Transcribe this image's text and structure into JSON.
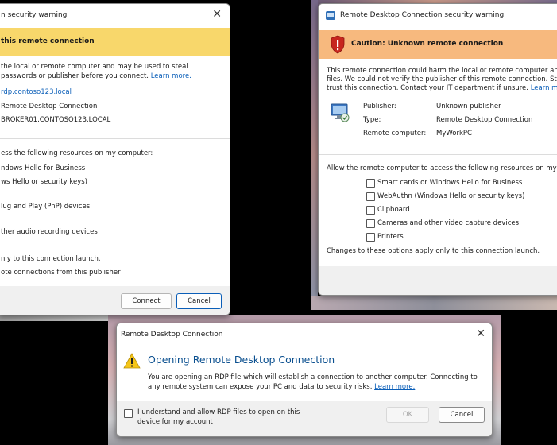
{
  "left_dialog": {
    "title": "n security warning",
    "banner": "this remote connection",
    "desc": "the local or remote computer and may be used to steal passwords or publisher before you connect.",
    "learn_more": "Learn more.",
    "info_values": [
      "rdp.contoso123.local",
      "Remote Desktop Connection",
      "BROKER01.CONTOSO123.LOCAL"
    ],
    "resources_header": "ess the following resources on my computer:",
    "resources": [
      "ndows Hello for Business",
      "ws Hello or security keys)",
      "lug and Play (PnP) devices",
      "ther audio recording devices"
    ],
    "footnote1": "nly to this connection launch.",
    "footnote2": "ote connections from this publisher",
    "connect": "Connect",
    "cancel": "Cancel",
    "close": "✕"
  },
  "right_dialog": {
    "title": "Remote Desktop Connection security warning",
    "banner": "Caution: Unknown remote connection",
    "desc_line1": "This remote connection could harm the local or remote computer and may b",
    "desc_line2": "files. We could not verify the publisher of this remote connection. Stop nov",
    "desc_line3": "trust this connection. Contact your IT department if unsure.",
    "learn_more": "Learn more.",
    "fields": [
      {
        "label": "Publisher:",
        "value": "Unknown publisher"
      },
      {
        "label": "Type:",
        "value": "Remote Desktop Connection"
      },
      {
        "label": "Remote computer:",
        "value": "MyWorkPC"
      }
    ],
    "resources_header": "Allow the remote computer to access the following resources on my compu",
    "resources": [
      "Smart cards or Windows Hello for Business",
      "WebAuthn (Windows Hello or security keys)",
      "Clipboard",
      "Cameras and other video capture devices",
      "Printers"
    ],
    "footnote": "Changes to these options apply only to this connection launch."
  },
  "bottom_dialog": {
    "title": "Remote Desktop Connection",
    "heading": "Opening Remote Desktop Connection",
    "body_line1": "You are opening an RDP file which will establish a connection to another computer. Connecting to",
    "body_line2": "any remote system can expose your PC and data to security risks.",
    "learn_more": "Learn more.",
    "checkbox_label_line1": "I understand and allow RDP files to open on this",
    "checkbox_label_line2": "device for my account",
    "ok": "OK",
    "cancel": "Cancel",
    "close": "✕"
  },
  "colors": {
    "banner_yellow": "#f8d76b",
    "banner_orange": "#f7b97e",
    "link": "#0a5eb8",
    "accent": "#0a5eb8"
  }
}
